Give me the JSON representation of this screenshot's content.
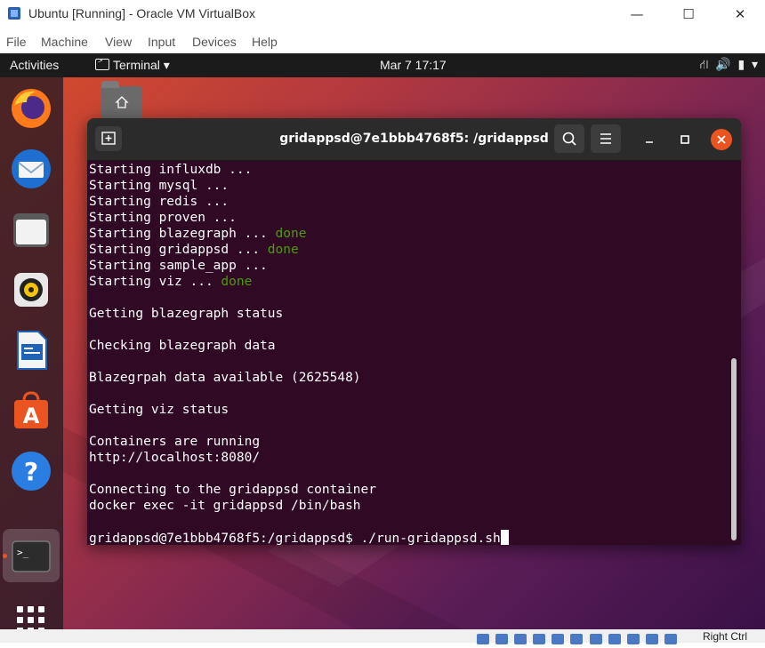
{
  "host_window": {
    "title": "Ubuntu [Running] - Oracle VM VirtualBox",
    "controls": {
      "minimize": "—",
      "maximize": "☐",
      "close": "✕"
    },
    "menu": [
      "File",
      "Machine",
      "View",
      "Input",
      "Devices",
      "Help"
    ],
    "status": {
      "host_key": "Right Ctrl"
    }
  },
  "ubuntu": {
    "top_bar": {
      "activities": "Activities",
      "app_menu": "Terminal ▾",
      "clock": "Mar 7  17:17",
      "tray": {
        "network": "⛙",
        "volume": "🔊",
        "battery": "▮",
        "menu": "▾"
      }
    },
    "dock": [
      {
        "name": "Firefox",
        "icon": "firefox-icon"
      },
      {
        "name": "Thunderbird",
        "icon": "thunderbird-icon"
      },
      {
        "name": "Files",
        "icon": "files-icon"
      },
      {
        "name": "Rhythmbox",
        "icon": "rhythmbox-icon"
      },
      {
        "name": "LibreOffice Writer",
        "icon": "writer-icon"
      },
      {
        "name": "Ubuntu Software",
        "icon": "software-icon"
      },
      {
        "name": "Help",
        "icon": "help-icon"
      },
      {
        "name": "Terminal",
        "icon": "terminal-icon"
      },
      {
        "name": "Show Applications",
        "icon": "app-grid-icon"
      }
    ],
    "desktop": {
      "home_icon": "home-folder-icon"
    }
  },
  "terminal": {
    "title": "gridappsd@7e1bbb4768f5: /gridappsd",
    "lines": [
      {
        "text": "Starting influxdb ...",
        "status": ""
      },
      {
        "text": "Starting mysql ...",
        "status": ""
      },
      {
        "text": "Starting redis ...",
        "status": ""
      },
      {
        "text": "Starting proven ...",
        "status": ""
      },
      {
        "text": "Starting blazegraph ... ",
        "status": "done"
      },
      {
        "text": "Starting gridappsd ... ",
        "status": "done"
      },
      {
        "text": "Starting sample_app ...",
        "status": ""
      },
      {
        "text": "Starting viz ... ",
        "status": "done"
      },
      {
        "text": "",
        "status": ""
      },
      {
        "text": "Getting blazegraph status",
        "status": ""
      },
      {
        "text": "",
        "status": ""
      },
      {
        "text": "Checking blazegraph data",
        "status": ""
      },
      {
        "text": "",
        "status": ""
      },
      {
        "text": "Blazegrpah data available (2625548)",
        "status": ""
      },
      {
        "text": "",
        "status": ""
      },
      {
        "text": "Getting viz status",
        "status": ""
      },
      {
        "text": "",
        "status": ""
      },
      {
        "text": "Containers are running",
        "status": ""
      },
      {
        "text": "http://localhost:8080/",
        "status": ""
      },
      {
        "text": "",
        "status": ""
      },
      {
        "text": "Connecting to the gridappsd container",
        "status": ""
      },
      {
        "text": "docker exec -it gridappsd /bin/bash",
        "status": ""
      },
      {
        "text": "",
        "status": ""
      }
    ],
    "prompt": "gridappsd@7e1bbb4768f5:/gridappsd$ ",
    "command": "./run-gridappsd.sh"
  }
}
